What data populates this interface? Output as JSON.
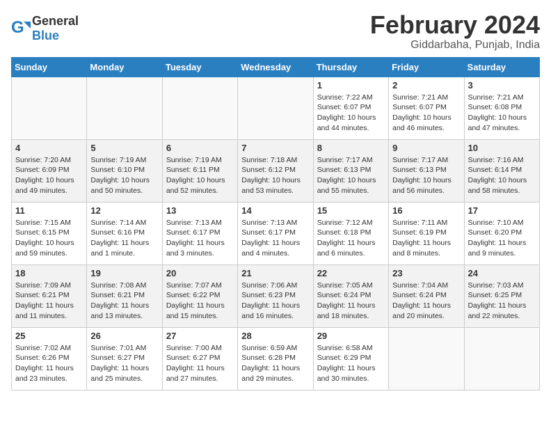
{
  "header": {
    "logo_general": "General",
    "logo_blue": "Blue",
    "month_title": "February 2024",
    "location": "Giddarbaha, Punjab, India"
  },
  "days_of_week": [
    "Sunday",
    "Monday",
    "Tuesday",
    "Wednesday",
    "Thursday",
    "Friday",
    "Saturday"
  ],
  "weeks": [
    [
      {
        "day": "",
        "sunrise": "",
        "sunset": "",
        "daylight": "",
        "empty": true
      },
      {
        "day": "",
        "sunrise": "",
        "sunset": "",
        "daylight": "",
        "empty": true
      },
      {
        "day": "",
        "sunrise": "",
        "sunset": "",
        "daylight": "",
        "empty": true
      },
      {
        "day": "",
        "sunrise": "",
        "sunset": "",
        "daylight": "",
        "empty": true
      },
      {
        "day": "1",
        "sunrise": "Sunrise: 7:22 AM",
        "sunset": "Sunset: 6:07 PM",
        "daylight": "Daylight: 10 hours and 44 minutes.",
        "empty": false
      },
      {
        "day": "2",
        "sunrise": "Sunrise: 7:21 AM",
        "sunset": "Sunset: 6:07 PM",
        "daylight": "Daylight: 10 hours and 46 minutes.",
        "empty": false
      },
      {
        "day": "3",
        "sunrise": "Sunrise: 7:21 AM",
        "sunset": "Sunset: 6:08 PM",
        "daylight": "Daylight: 10 hours and 47 minutes.",
        "empty": false
      }
    ],
    [
      {
        "day": "4",
        "sunrise": "Sunrise: 7:20 AM",
        "sunset": "Sunset: 6:09 PM",
        "daylight": "Daylight: 10 hours and 49 minutes.",
        "empty": false
      },
      {
        "day": "5",
        "sunrise": "Sunrise: 7:19 AM",
        "sunset": "Sunset: 6:10 PM",
        "daylight": "Daylight: 10 hours and 50 minutes.",
        "empty": false
      },
      {
        "day": "6",
        "sunrise": "Sunrise: 7:19 AM",
        "sunset": "Sunset: 6:11 PM",
        "daylight": "Daylight: 10 hours and 52 minutes.",
        "empty": false
      },
      {
        "day": "7",
        "sunrise": "Sunrise: 7:18 AM",
        "sunset": "Sunset: 6:12 PM",
        "daylight": "Daylight: 10 hours and 53 minutes.",
        "empty": false
      },
      {
        "day": "8",
        "sunrise": "Sunrise: 7:17 AM",
        "sunset": "Sunset: 6:13 PM",
        "daylight": "Daylight: 10 hours and 55 minutes.",
        "empty": false
      },
      {
        "day": "9",
        "sunrise": "Sunrise: 7:17 AM",
        "sunset": "Sunset: 6:13 PM",
        "daylight": "Daylight: 10 hours and 56 minutes.",
        "empty": false
      },
      {
        "day": "10",
        "sunrise": "Sunrise: 7:16 AM",
        "sunset": "Sunset: 6:14 PM",
        "daylight": "Daylight: 10 hours and 58 minutes.",
        "empty": false
      }
    ],
    [
      {
        "day": "11",
        "sunrise": "Sunrise: 7:15 AM",
        "sunset": "Sunset: 6:15 PM",
        "daylight": "Daylight: 10 hours and 59 minutes.",
        "empty": false
      },
      {
        "day": "12",
        "sunrise": "Sunrise: 7:14 AM",
        "sunset": "Sunset: 6:16 PM",
        "daylight": "Daylight: 11 hours and 1 minute.",
        "empty": false
      },
      {
        "day": "13",
        "sunrise": "Sunrise: 7:13 AM",
        "sunset": "Sunset: 6:17 PM",
        "daylight": "Daylight: 11 hours and 3 minutes.",
        "empty": false
      },
      {
        "day": "14",
        "sunrise": "Sunrise: 7:13 AM",
        "sunset": "Sunset: 6:17 PM",
        "daylight": "Daylight: 11 hours and 4 minutes.",
        "empty": false
      },
      {
        "day": "15",
        "sunrise": "Sunrise: 7:12 AM",
        "sunset": "Sunset: 6:18 PM",
        "daylight": "Daylight: 11 hours and 6 minutes.",
        "empty": false
      },
      {
        "day": "16",
        "sunrise": "Sunrise: 7:11 AM",
        "sunset": "Sunset: 6:19 PM",
        "daylight": "Daylight: 11 hours and 8 minutes.",
        "empty": false
      },
      {
        "day": "17",
        "sunrise": "Sunrise: 7:10 AM",
        "sunset": "Sunset: 6:20 PM",
        "daylight": "Daylight: 11 hours and 9 minutes.",
        "empty": false
      }
    ],
    [
      {
        "day": "18",
        "sunrise": "Sunrise: 7:09 AM",
        "sunset": "Sunset: 6:21 PM",
        "daylight": "Daylight: 11 hours and 11 minutes.",
        "empty": false
      },
      {
        "day": "19",
        "sunrise": "Sunrise: 7:08 AM",
        "sunset": "Sunset: 6:21 PM",
        "daylight": "Daylight: 11 hours and 13 minutes.",
        "empty": false
      },
      {
        "day": "20",
        "sunrise": "Sunrise: 7:07 AM",
        "sunset": "Sunset: 6:22 PM",
        "daylight": "Daylight: 11 hours and 15 minutes.",
        "empty": false
      },
      {
        "day": "21",
        "sunrise": "Sunrise: 7:06 AM",
        "sunset": "Sunset: 6:23 PM",
        "daylight": "Daylight: 11 hours and 16 minutes.",
        "empty": false
      },
      {
        "day": "22",
        "sunrise": "Sunrise: 7:05 AM",
        "sunset": "Sunset: 6:24 PM",
        "daylight": "Daylight: 11 hours and 18 minutes.",
        "empty": false
      },
      {
        "day": "23",
        "sunrise": "Sunrise: 7:04 AM",
        "sunset": "Sunset: 6:24 PM",
        "daylight": "Daylight: 11 hours and 20 minutes.",
        "empty": false
      },
      {
        "day": "24",
        "sunrise": "Sunrise: 7:03 AM",
        "sunset": "Sunset: 6:25 PM",
        "daylight": "Daylight: 11 hours and 22 minutes.",
        "empty": false
      }
    ],
    [
      {
        "day": "25",
        "sunrise": "Sunrise: 7:02 AM",
        "sunset": "Sunset: 6:26 PM",
        "daylight": "Daylight: 11 hours and 23 minutes.",
        "empty": false
      },
      {
        "day": "26",
        "sunrise": "Sunrise: 7:01 AM",
        "sunset": "Sunset: 6:27 PM",
        "daylight": "Daylight: 11 hours and 25 minutes.",
        "empty": false
      },
      {
        "day": "27",
        "sunrise": "Sunrise: 7:00 AM",
        "sunset": "Sunset: 6:27 PM",
        "daylight": "Daylight: 11 hours and 27 minutes.",
        "empty": false
      },
      {
        "day": "28",
        "sunrise": "Sunrise: 6:59 AM",
        "sunset": "Sunset: 6:28 PM",
        "daylight": "Daylight: 11 hours and 29 minutes.",
        "empty": false
      },
      {
        "day": "29",
        "sunrise": "Sunrise: 6:58 AM",
        "sunset": "Sunset: 6:29 PM",
        "daylight": "Daylight: 11 hours and 30 minutes.",
        "empty": false
      },
      {
        "day": "",
        "sunrise": "",
        "sunset": "",
        "daylight": "",
        "empty": true
      },
      {
        "day": "",
        "sunrise": "",
        "sunset": "",
        "daylight": "",
        "empty": true
      }
    ]
  ]
}
